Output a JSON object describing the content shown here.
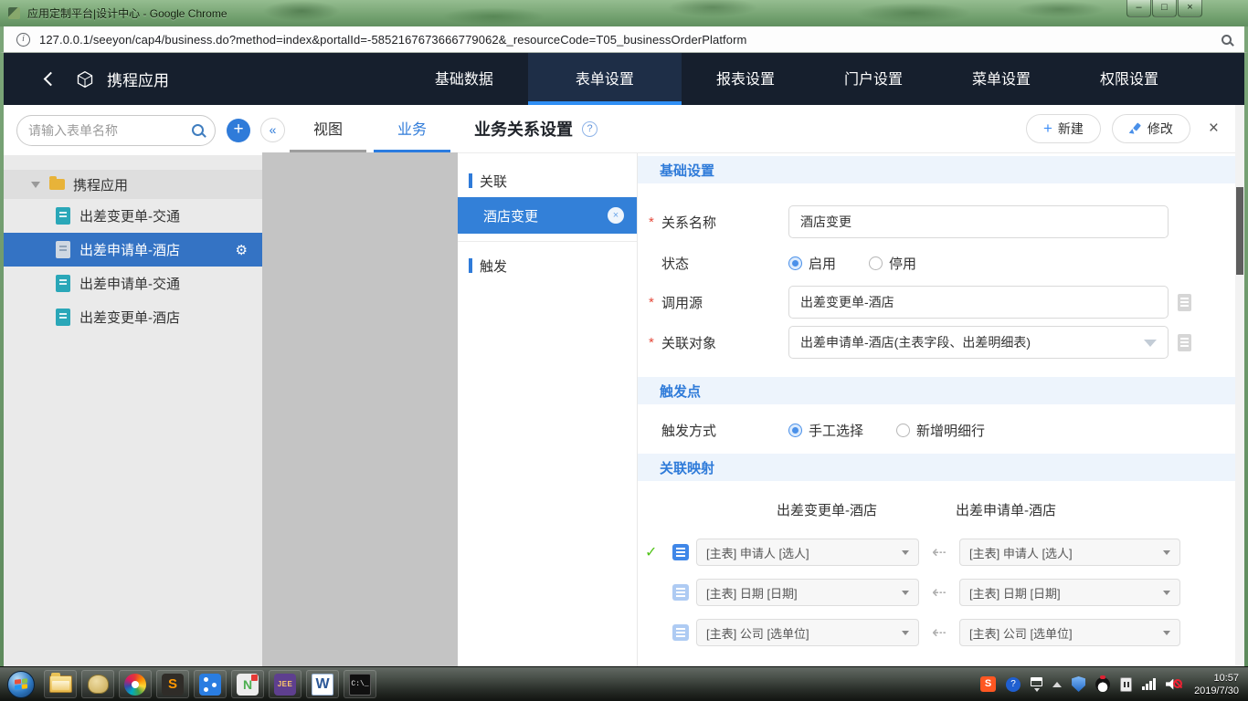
{
  "window": {
    "title": "应用定制平台|设计中心 - Google Chrome",
    "url": "127.0.0.1/seeyon/cap4/business.do?method=index&portalId=-5852167673666779062&_resourceCode=T05_businessOrderPlatform",
    "controls": {
      "minimize": "–",
      "maximize": "□",
      "close": "×"
    }
  },
  "navbar": {
    "app_name": "携程应用",
    "tabs": [
      {
        "label": "基础数据",
        "active": false
      },
      {
        "label": "表单设置",
        "active": true
      },
      {
        "label": "报表设置",
        "active": false
      },
      {
        "label": "门户设置",
        "active": false
      },
      {
        "label": "菜单设置",
        "active": false
      },
      {
        "label": "权限设置",
        "active": false
      }
    ]
  },
  "sidebar": {
    "search_placeholder": "请输入表单名称",
    "folder_label": "携程应用",
    "items": [
      {
        "label": "出差变更单-交通",
        "selected": false
      },
      {
        "label": "出差申请单-酒店",
        "selected": true
      },
      {
        "label": "出差申请单-交通",
        "selected": false
      },
      {
        "label": "出差变更单-酒店",
        "selected": false
      }
    ]
  },
  "canvas": {
    "tabs": [
      {
        "label": "视图",
        "active": false
      },
      {
        "label": "业务",
        "active": true
      }
    ]
  },
  "panel": {
    "title": "业务关系设置",
    "help": "?",
    "actions": {
      "new_label": "新建",
      "edit_label": "修改",
      "close": "×"
    },
    "subnav": {
      "group_assoc": "关联",
      "selected_item": "酒店变更",
      "group_trigger": "触发"
    },
    "basic": {
      "title": "基础设置",
      "name_label": "关系名称",
      "name_value": "酒店变更",
      "status_label": "状态",
      "status_on": "启用",
      "status_off": "停用",
      "status_selected": "启用",
      "source_label": "调用源",
      "source_value": "出差变更单-酒店",
      "target_label": "关联对象",
      "target_value": "出差申请单-酒店(主表字段、出差明细表)"
    },
    "trigger": {
      "title": "触发点",
      "mode_label": "触发方式",
      "mode_manual": "手工选择",
      "mode_newrow": "新增明细行",
      "mode_selected": "手工选择"
    },
    "mapping": {
      "title": "关联映射",
      "left_header": "出差变更单-酒店",
      "right_header": "出差申请单-酒店",
      "rows": [
        {
          "left": "[主表] 申请人 [选人]",
          "right": "[主表] 申请人 [选人]",
          "checked": true
        },
        {
          "left": "[主表] 日期 [日期]",
          "right": "[主表] 日期 [日期]",
          "checked": false
        },
        {
          "left": "[主表] 公司 [选单位]",
          "right": "[主表] 公司 [选单位]",
          "checked": false
        }
      ]
    }
  },
  "icons": {
    "collapse": "«",
    "gear": "⚙",
    "plus": "+",
    "check": "✓",
    "map_arrow": "⇠",
    "info": "i",
    "required": "*",
    "subnav_close": "×"
  },
  "taskbar": {
    "glyphs": {
      "sublime": "S",
      "notepadpp": "N",
      "javaee": "JEE",
      "word": "W",
      "cmd": "C:\\_",
      "sogou": "S",
      "help": "?"
    },
    "clock": {
      "time": "10:57",
      "date": "2019/7/30"
    }
  },
  "colors": {
    "accent_blue": "#2f7bd9",
    "nav_bg": "#161f2d",
    "selected_row": "#3473c4",
    "title_green": "#7fa87b",
    "band_bg": "#edf4fc",
    "subnav_selected": "#3380d8"
  }
}
